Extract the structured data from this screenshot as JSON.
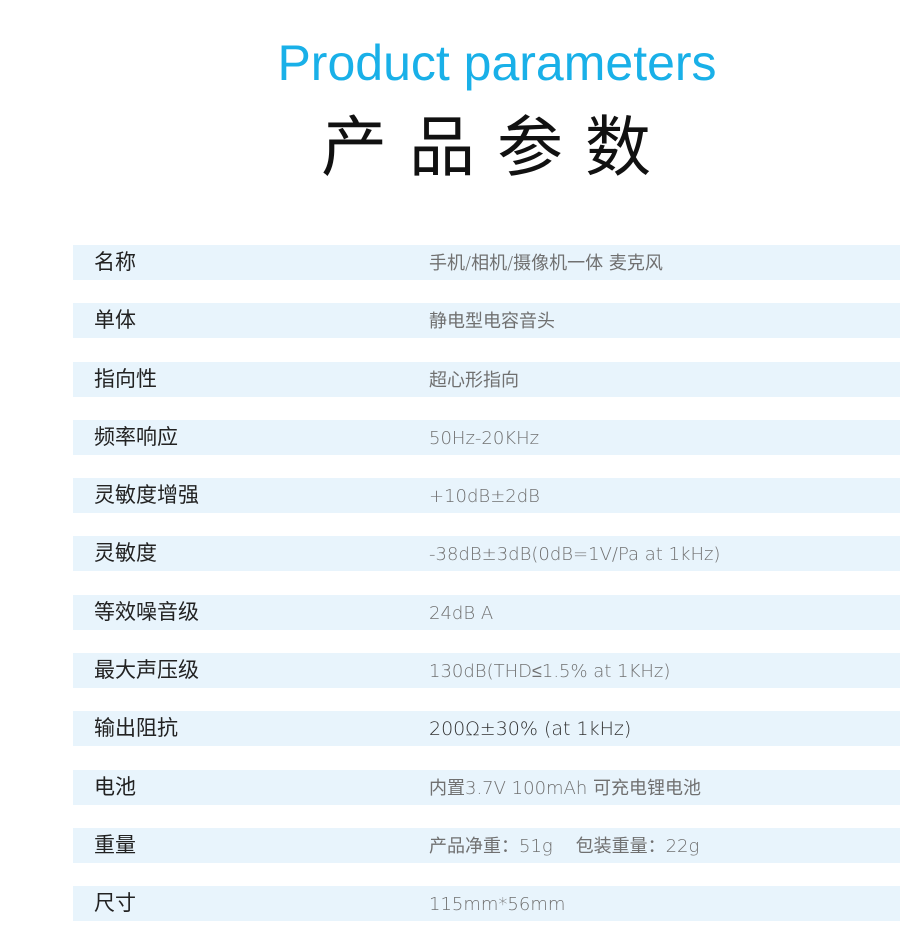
{
  "header": {
    "title_en": "Product parameters",
    "title_cn": "产品参数"
  },
  "colors": {
    "accent": "#19b0e8",
    "row_background": "#e8f4fc",
    "label_text": "#222222",
    "value_text": "#707070"
  },
  "specs": [
    {
      "label": "名称",
      "value": "手机/相机/摄像机一体  麦克风"
    },
    {
      "label": "单体",
      "value": "静电型电容音头"
    },
    {
      "label": "指向性",
      "value": "超心形指向"
    },
    {
      "label": "频率响应",
      "value": "50Hz-20KHz"
    },
    {
      "label": "灵敏度增强",
      "value": "+10dB±2dB"
    },
    {
      "label": "灵敏度",
      "value": "-38dB±3dB(0dB=1V/Pa at 1kHz)"
    },
    {
      "label": "等效噪音级",
      "value": "24dB A"
    },
    {
      "label": "最大声压级",
      "value": "130dB(THD≤1.5% at 1KHz)"
    },
    {
      "label": "输出阻抗",
      "value": "200Ω±30%  (at 1kHz)"
    },
    {
      "label": "电池",
      "value": "内置3.7V 100mAh 可充电锂电池"
    },
    {
      "label": "重量",
      "value": "产品净重：51g    包装重量：22g"
    },
    {
      "label": "尺寸",
      "value": "115mm*56mm"
    }
  ]
}
